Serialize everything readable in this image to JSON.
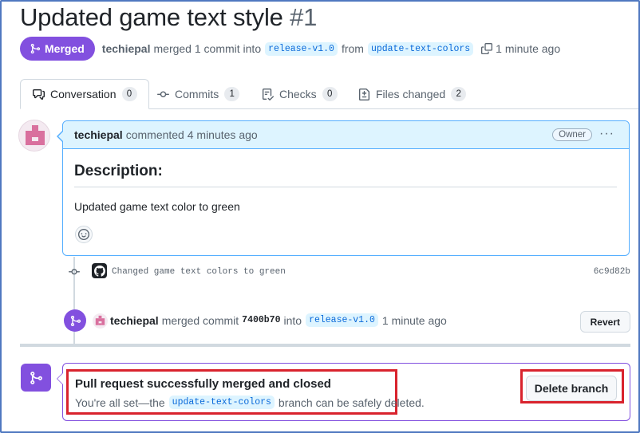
{
  "pr": {
    "title": "Updated game text style",
    "number": "#1",
    "status": "Merged",
    "author": "techiepal",
    "merged_text": "merged 1 commit into",
    "base_branch": "release-v1.0",
    "from_text": "from",
    "head_branch": "update-text-colors",
    "time": "1 minute ago"
  },
  "tabs": [
    {
      "label": "Conversation",
      "count": "0",
      "icon": "comment-discussion-icon"
    },
    {
      "label": "Commits",
      "count": "1",
      "icon": "git-commit-icon"
    },
    {
      "label": "Checks",
      "count": "0",
      "icon": "checklist-icon"
    },
    {
      "label": "Files changed",
      "count": "2",
      "icon": "file-diff-icon"
    }
  ],
  "comment": {
    "author": "techiepal",
    "action": "commented 4 minutes ago",
    "role": "Owner",
    "menu": "···",
    "heading": "Description:",
    "body": "Updated game text color to green"
  },
  "commit": {
    "message": "Changed game text colors to green",
    "sha": "6c9d82b"
  },
  "merge_event": {
    "author": "techiepal",
    "text1": "merged commit",
    "sha": "7400b70",
    "text2": "into",
    "branch": "release-v1.0",
    "time": "1 minute ago",
    "revert_label": "Revert"
  },
  "merge_box": {
    "title": "Pull request successfully merged and closed",
    "sub_prefix": "You're all set—the",
    "branch": "update-text-colors",
    "sub_suffix": "branch can be safely deleted.",
    "delete_label": "Delete branch"
  },
  "colors": {
    "merged_purple": "#8250df",
    "highlight_red": "#d9232d",
    "link_blue": "#0969da"
  }
}
